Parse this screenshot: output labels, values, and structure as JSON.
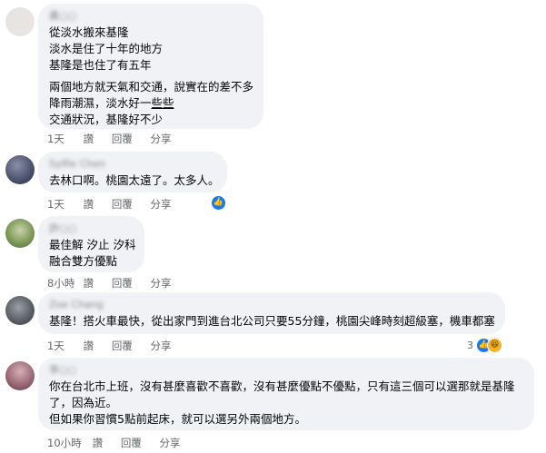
{
  "comments": [
    {
      "name": "黃○○",
      "lines": [
        "從淡水搬來基隆",
        "淡水是住了十年的地方",
        "基隆是也住了有五年",
        "",
        "兩個地方就天氣和交通，說實在的差不多",
        "降雨潮濕，淡水好一些些",
        "交通狀況，基隆好不少"
      ],
      "time": "1天",
      "like": "讚",
      "reply": "回覆",
      "share": "分享"
    },
    {
      "name": "Sylfie Chen",
      "lines": [
        "去林口啊。桃園太遠了。太多人。"
      ],
      "time": "1天",
      "like": "讚",
      "reply": "回覆",
      "share": "分享",
      "reaction_icons": [
        "like-icon"
      ]
    },
    {
      "name": "許○○",
      "lines": [
        "最佳解 汐止 汐科",
        "融合雙方優點"
      ],
      "time": "8小時",
      "like": "讚",
      "reply": "回覆",
      "share": "分享"
    },
    {
      "name": "Zoe Chang",
      "lines": [
        "基隆！搭火車最快，從出家門到進台北公司只要55分鐘，桃園尖峰時刻超級塞，機車都塞"
      ],
      "time": "1天",
      "like": "讚",
      "reply": "回覆",
      "share": "分享",
      "reaction_count": "3",
      "reaction_icons": [
        "like-icon",
        "haha-icon"
      ]
    },
    {
      "name": "李○○",
      "lines": [
        "你在台北市上班，沒有甚麼喜歡不喜歡，沒有甚麼優點不優點，只有這三個可以選那就是基隆",
        "了，因為近。",
        "但如果你習慣5點前起床，就可以選另外兩個地方。"
      ],
      "time": "10小時",
      "like": "讚",
      "reply": "回覆",
      "share": "分享"
    }
  ],
  "colors": {
    "bubble": "#f0f2f5",
    "meta": "#65676b",
    "like": "#1877f2",
    "haha": "#f7b125"
  }
}
